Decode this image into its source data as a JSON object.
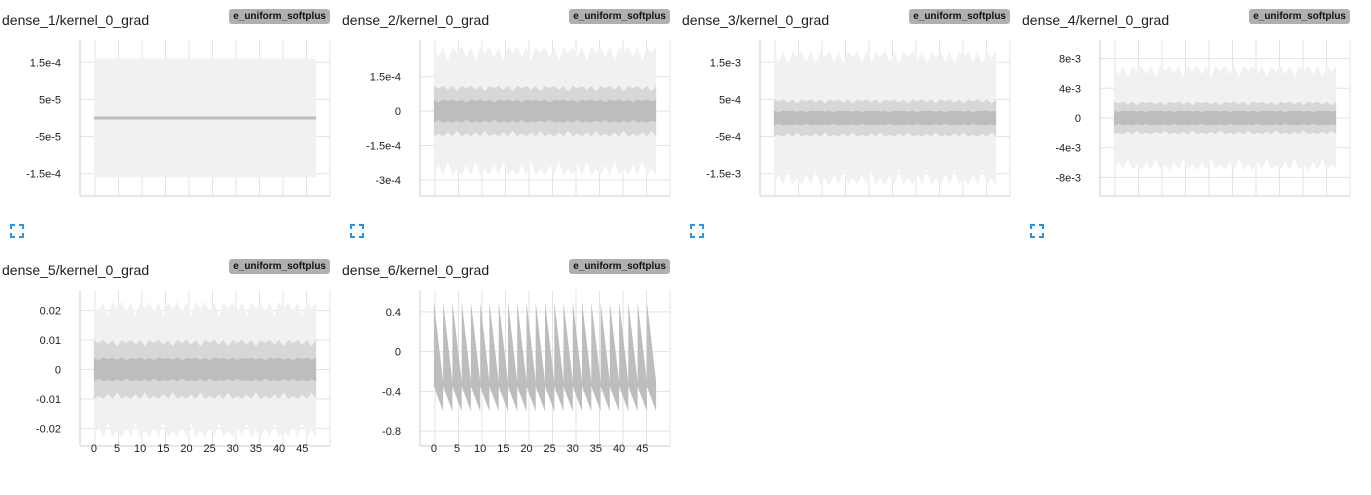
{
  "run_tag": "e_uniform_softplus",
  "colors": {
    "band_outer": "#f1f1f1",
    "band_mid": "#d7d7d7",
    "band_inner": "#bdbdbd",
    "grid": "#e3e3e3",
    "axis_text": "#212121",
    "expand_icon": "#2196f3"
  },
  "icons": {
    "expand": "fullscreen-icon"
  },
  "chart_data": [
    {
      "type": "area",
      "title": "dense_1/kernel_0_grad",
      "yticks": [
        0.00015,
        5e-05,
        -5e-05,
        -0.00015
      ],
      "ytick_labels": [
        "1.5e-4",
        "5e-5",
        "-5e-5",
        "-1.5e-4"
      ],
      "ylim": [
        -0.00021,
        0.00021
      ],
      "xlim": [
        -3,
        51
      ],
      "x": [
        0,
        48
      ],
      "band": {
        "outer": 0.00016,
        "mid": 5e-06,
        "inner": 3e-06,
        "jagged": false
      },
      "show_xticks": false,
      "grid": true
    },
    {
      "type": "area",
      "title": "dense_2/kernel_0_grad",
      "yticks": [
        0.00015,
        0,
        -0.00015,
        -0.0003
      ],
      "ytick_labels": [
        "1.5e-4",
        "0",
        "-1.5e-4",
        "-3e-4"
      ],
      "ylim": [
        -0.00037,
        0.00031
      ],
      "xlim": [
        -3,
        51
      ],
      "x": [
        0,
        48
      ],
      "band": {
        "outer": 0.00028,
        "mid": 0.00011,
        "inner": 5e-05,
        "jagged": true
      },
      "show_xticks": false,
      "grid": true
    },
    {
      "type": "area",
      "title": "dense_3/kernel_0_grad",
      "yticks": [
        0.0015,
        0.0005,
        -0.0005,
        -0.0015
      ],
      "ytick_labels": [
        "1.5e-3",
        "5e-4",
        "-5e-4",
        "-1.5e-3"
      ],
      "ylim": [
        -0.0021,
        0.0021
      ],
      "xlim": [
        -3,
        51
      ],
      "x": [
        0,
        48
      ],
      "band": {
        "outer": 0.0018,
        "mid": 0.0005,
        "inner": 0.0002,
        "jagged": true
      },
      "show_xticks": false,
      "grid": true
    },
    {
      "type": "area",
      "title": "dense_4/kernel_0_grad",
      "yticks": [
        0.008,
        0.004,
        0,
        -0.004,
        -0.008
      ],
      "ytick_labels": [
        "8e-3",
        "4e-3",
        "0",
        "-4e-3",
        "-8e-3"
      ],
      "ylim": [
        -0.0105,
        0.0105
      ],
      "xlim": [
        -3,
        51
      ],
      "x": [
        0,
        48
      ],
      "band": {
        "outer": 0.007,
        "mid": 0.0022,
        "inner": 0.001,
        "jagged": true
      },
      "show_xticks": false,
      "grid": true
    },
    {
      "type": "area",
      "title": "dense_5/kernel_0_grad",
      "yticks": [
        0.02,
        0.01,
        0,
        -0.01,
        -0.02
      ],
      "ytick_labels": [
        "0.02",
        "0.01",
        "0",
        "-0.01",
        "-0.02"
      ],
      "ylim": [
        -0.026,
        0.027
      ],
      "xlim": [
        -3,
        51
      ],
      "x": [
        0,
        48
      ],
      "band": {
        "outer": 0.023,
        "mid": 0.01,
        "inner": 0.004,
        "jagged": true
      },
      "show_xticks": true,
      "xticks": [
        0,
        5,
        10,
        15,
        20,
        25,
        30,
        35,
        40,
        45
      ],
      "xtick_labels": [
        "0",
        "5",
        "10",
        "15",
        "20",
        "25",
        "30",
        "35",
        "40",
        "45"
      ],
      "grid": true
    },
    {
      "type": "area",
      "title": "dense_6/kernel_0_grad",
      "yticks": [
        0.4,
        0,
        -0.4,
        -0.8
      ],
      "ytick_labels": [
        "0.4",
        "0",
        "-0.4",
        "-0.8"
      ],
      "ylim": [
        -0.95,
        0.62
      ],
      "xlim": [
        -3,
        51
      ],
      "x": [
        0,
        48
      ],
      "band": {
        "outer": 0.5,
        "mid": 0.5,
        "inner": 0.5,
        "jagged": true,
        "sawtooth": true
      },
      "show_xticks": true,
      "xticks": [
        0,
        5,
        10,
        15,
        20,
        25,
        30,
        35,
        40,
        45
      ],
      "xtick_labels": [
        "0",
        "5",
        "10",
        "15",
        "20",
        "25",
        "30",
        "35",
        "40",
        "45"
      ],
      "grid": true
    }
  ]
}
